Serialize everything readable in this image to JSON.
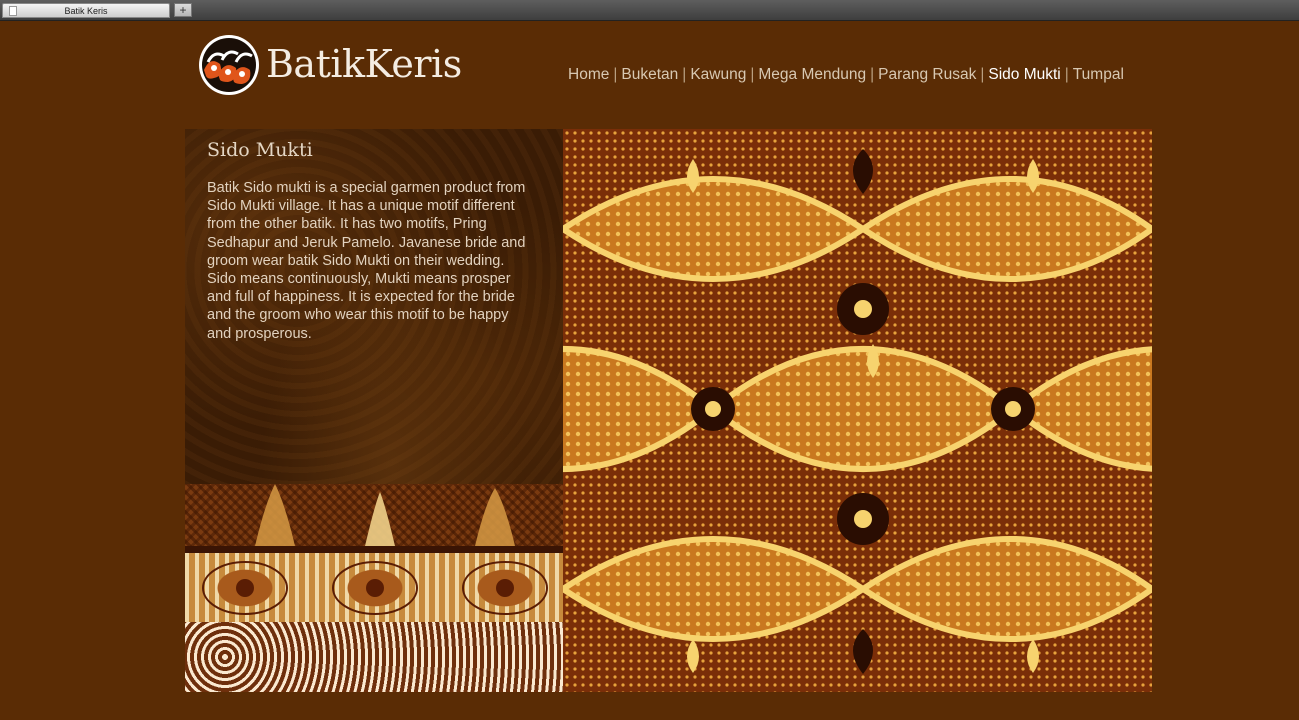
{
  "browser": {
    "tab_title": "Batik Keris",
    "new_tab_label": "+"
  },
  "brand": {
    "name": "BatikKeris",
    "colors": {
      "background": "#5a2c05",
      "logo_accent": "#e0551b"
    }
  },
  "nav": {
    "items": [
      {
        "label": "Home"
      },
      {
        "label": "Buketan"
      },
      {
        "label": "Kawung"
      },
      {
        "label": "Mega Mendung"
      },
      {
        "label": "Parang Rusak"
      },
      {
        "label": "Sido Mukti",
        "active": true
      },
      {
        "label": "Tumpal"
      }
    ],
    "separator": "|"
  },
  "article": {
    "title": "Sido Mukti",
    "body": "Batik Sido mukti is a special garmen product from Sido Mukti village. It has a unique motif different from the other batik. It has two motifs, Pring Sedhapur and Jeruk Pamelo. Javanese bride and groom wear batik Sido Mukti on their wedding. Sido means continuously, Mukti means prosper and full of happiness. It is expected for the bride and the groom who wear this motif to be happy and prosperous."
  }
}
